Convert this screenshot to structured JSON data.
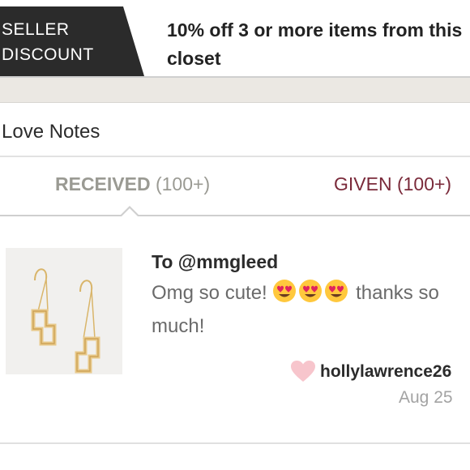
{
  "banner": {
    "tag_line1": "SELLER",
    "tag_line2": "DISCOUNT",
    "message": "10% off 3 or more items from this closet"
  },
  "header": {
    "title": "Love Notes"
  },
  "tabs": {
    "received": {
      "label": "RECEIVED",
      "count": "(100+)",
      "active": true
    },
    "given": {
      "label": "GIVEN",
      "count": "(100+)",
      "active": false
    }
  },
  "note": {
    "recipient": "To @mmgleed",
    "message_start": "Omg so cute!",
    "message_end": "thanks so much!",
    "emojis": [
      "heart-eyes-emoji",
      "heart-eyes-emoji",
      "heart-eyes-emoji"
    ],
    "author": "hollylawrence26",
    "date": "Aug 25",
    "image": "gold-geometric-earrings"
  },
  "colors": {
    "banner_tag": "#2b2b2b",
    "tab_received": "#9a9a93",
    "tab_given": "#7a2a3a",
    "heart": "#f7c5cc"
  }
}
